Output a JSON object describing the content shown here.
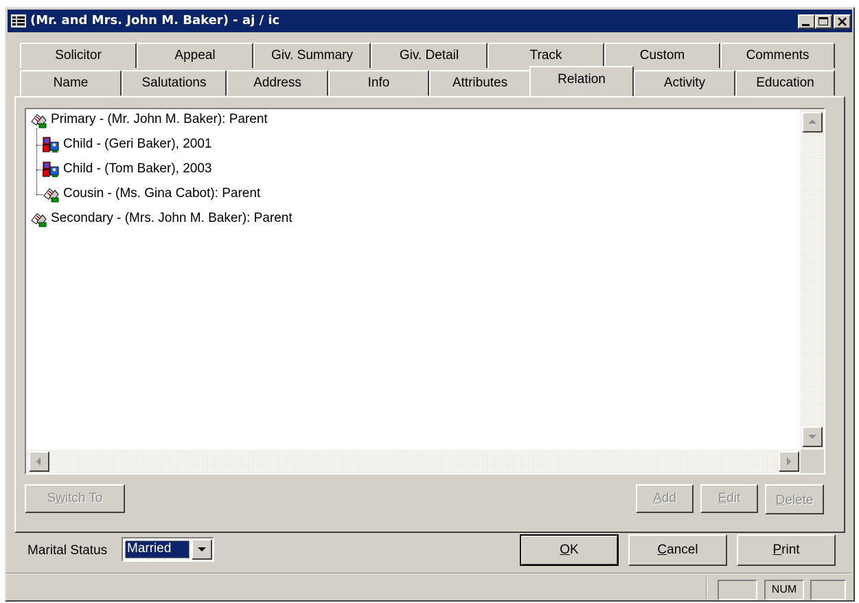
{
  "window": {
    "title": "(Mr. and Mrs. John M. Baker) - aj / ic",
    "icon": "record-window-icon",
    "controls": [
      "minimize",
      "maximize",
      "close"
    ]
  },
  "tabs": {
    "row_back": [
      "Solicitor",
      "Appeal",
      "Giv. Summary",
      "Giv. Detail",
      "Track",
      "Custom",
      "Comments"
    ],
    "row_front": [
      "Name",
      "Salutations",
      "Address",
      "Info",
      "Attributes",
      "Relation",
      "Activity",
      "Education"
    ],
    "active": "Relation"
  },
  "tree": {
    "nodes": [
      {
        "label": "Primary - (Mr. John M. Baker): Parent",
        "icon": "relation-handshake-icon"
      },
      {
        "label": "Child - (Geri Baker), 2001",
        "icon": "child-person-icon"
      },
      {
        "label": "Child - (Tom Baker), 2003",
        "icon": "child-person-icon"
      },
      {
        "label": "Cousin - (Ms. Gina Cabot): Parent",
        "icon": "relation-handshake-icon"
      },
      {
        "label": "Secondary - (Mrs. John M. Baker): Parent",
        "icon": "relation-handshake-icon"
      }
    ]
  },
  "buttons": {
    "switch_to": {
      "pre": "S",
      "key": "w",
      "post": "itch To"
    },
    "add": {
      "pre": "",
      "key": "A",
      "post": "dd"
    },
    "edit": {
      "pre": "",
      "key": "E",
      "post": "dit"
    },
    "delete": {
      "pre": "",
      "key": "D",
      "post": "elete"
    },
    "ok": {
      "pre": "",
      "key": "O",
      "post": "K"
    },
    "cancel": {
      "pre": "",
      "key": "C",
      "post": "ancel"
    },
    "print": {
      "pre": "",
      "key": "P",
      "post": "rint"
    }
  },
  "marital_status": {
    "label": "Marital Status",
    "value": "Married"
  },
  "statusbar": {
    "panels": [
      "",
      "NUM",
      ""
    ]
  },
  "colors": {
    "face": "#d4d0c8",
    "title_bar": "#0a246a",
    "selection": "#0a246a",
    "disabled_text": "#8e8e8e"
  }
}
